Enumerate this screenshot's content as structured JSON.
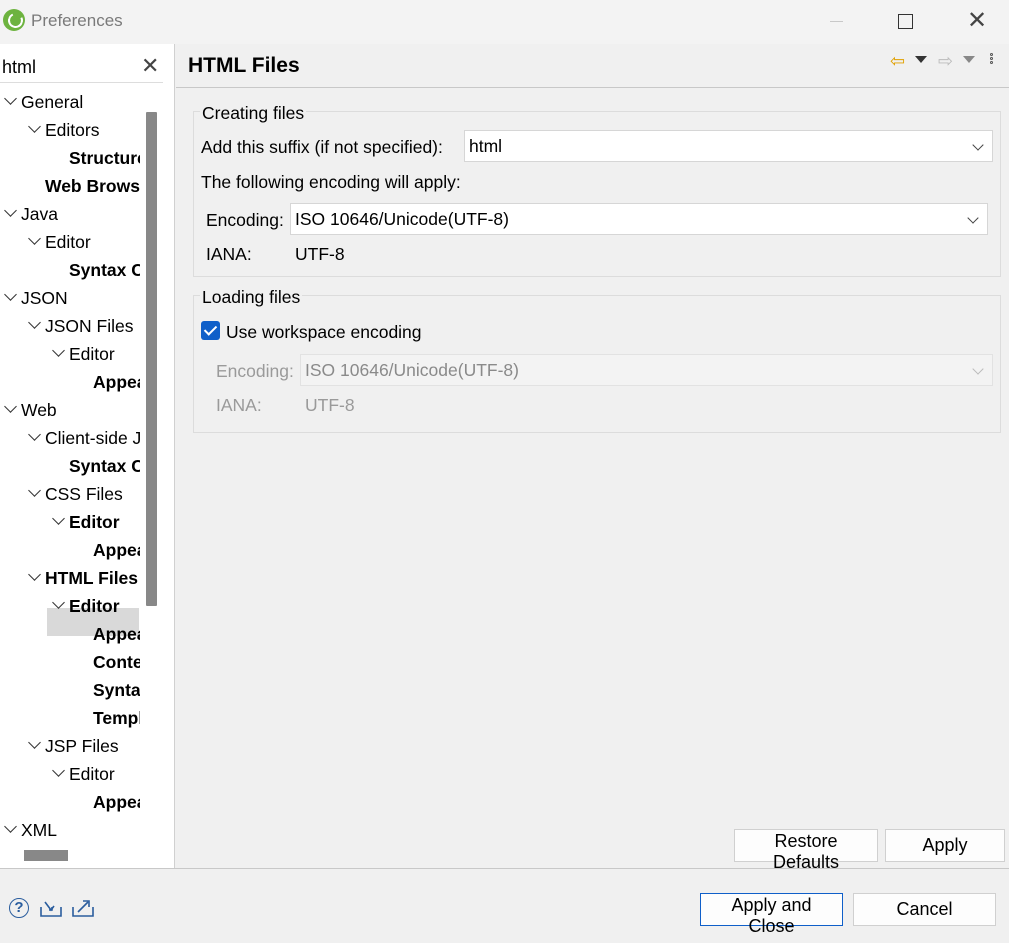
{
  "window": {
    "title": "Preferences"
  },
  "filter": {
    "value": "html"
  },
  "tree": [
    {
      "label": "General",
      "depth": 0,
      "expanded": true,
      "bold": false
    },
    {
      "label": "Editors",
      "depth": 1,
      "expanded": true,
      "bold": false
    },
    {
      "label": "Structured Text Editors",
      "depth": 2,
      "expanded": null,
      "bold": true
    },
    {
      "label": "Web Browser",
      "depth": 1,
      "expanded": null,
      "bold": true
    },
    {
      "label": "Java",
      "depth": 0,
      "expanded": true,
      "bold": false
    },
    {
      "label": "Editor",
      "depth": 1,
      "expanded": true,
      "bold": false
    },
    {
      "label": "Syntax Coloring",
      "depth": 2,
      "expanded": null,
      "bold": true
    },
    {
      "label": "JSON",
      "depth": 0,
      "expanded": true,
      "bold": false
    },
    {
      "label": "JSON Files",
      "depth": 1,
      "expanded": true,
      "bold": false
    },
    {
      "label": "Editor",
      "depth": 2,
      "expanded": true,
      "bold": false
    },
    {
      "label": "Appearance",
      "depth": 3,
      "expanded": null,
      "bold": true
    },
    {
      "label": "Web",
      "depth": 0,
      "expanded": true,
      "bold": false
    },
    {
      "label": "Client-side JavaScript",
      "depth": 1,
      "expanded": true,
      "bold": false
    },
    {
      "label": "Syntax Coloring",
      "depth": 2,
      "expanded": null,
      "bold": true
    },
    {
      "label": "CSS Files",
      "depth": 1,
      "expanded": true,
      "bold": false
    },
    {
      "label": "Editor",
      "depth": 2,
      "expanded": true,
      "bold": true
    },
    {
      "label": "Appearance",
      "depth": 3,
      "expanded": null,
      "bold": true
    },
    {
      "label": "HTML Files",
      "depth": 1,
      "expanded": true,
      "bold": true,
      "selected": true
    },
    {
      "label": "Editor",
      "depth": 2,
      "expanded": true,
      "bold": true
    },
    {
      "label": "Appearance",
      "depth": 3,
      "expanded": null,
      "bold": true
    },
    {
      "label": "Content Assist",
      "depth": 3,
      "expanded": null,
      "bold": true
    },
    {
      "label": "Syntax Coloring",
      "depth": 3,
      "expanded": null,
      "bold": true
    },
    {
      "label": "Templates",
      "depth": 3,
      "expanded": null,
      "bold": true
    },
    {
      "label": "JSP Files",
      "depth": 1,
      "expanded": true,
      "bold": false
    },
    {
      "label": "Editor",
      "depth": 2,
      "expanded": true,
      "bold": false
    },
    {
      "label": "Appearance",
      "depth": 3,
      "expanded": null,
      "bold": true
    },
    {
      "label": "XML",
      "depth": 0,
      "expanded": true,
      "bold": false
    }
  ],
  "page": {
    "title": "HTML Files",
    "creating": {
      "legend": "Creating files",
      "suffix_label": "Add this suffix (if not specified):",
      "suffix_value": "html",
      "encoding_note": "The following encoding will apply:",
      "encoding_label": "Encoding:",
      "encoding_value": "ISO 10646/Unicode(UTF-8)",
      "iana_label": "IANA:",
      "iana_value": "UTF-8"
    },
    "loading": {
      "legend": "Loading files",
      "checkbox_label": "Use workspace encoding",
      "checked": true,
      "encoding_label": "Encoding:",
      "encoding_value": "ISO 10646/Unicode(UTF-8)",
      "iana_label": "IANA:",
      "iana_value": "UTF-8"
    },
    "restore_defaults": "Restore Defaults",
    "apply": "Apply"
  },
  "footer": {
    "apply_and_close": "Apply and Close",
    "cancel": "Cancel",
    "help_icon": "question-icon",
    "import_icon": "import-icon",
    "export_icon": "export-icon"
  },
  "colors": {
    "accent": "#0f5fc9",
    "back_arrow": "#e0a000"
  }
}
